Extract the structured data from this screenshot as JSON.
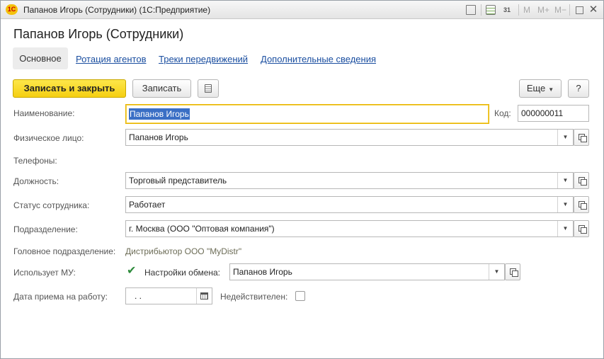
{
  "window": {
    "title": "Папанов Игорь (Сотрудники)  (1С:Предприятие)",
    "logo_text": "1С",
    "mem_buttons": [
      "M",
      "M+",
      "M−"
    ],
    "calendar_day": "31"
  },
  "header": {
    "title": "Папанов Игорь (Сотрудники)"
  },
  "tabs": [
    {
      "label": "Основное",
      "active": true
    },
    {
      "label": "Ротация агентов",
      "active": false
    },
    {
      "label": "Треки передвижений",
      "active": false
    },
    {
      "label": "Дополнительные сведения",
      "active": false
    }
  ],
  "toolbar": {
    "save_close_label": "Записать и закрыть",
    "save_label": "Записать",
    "more_label": "Еще",
    "help_label": "?"
  },
  "form": {
    "name_label": "Наименование:",
    "name_value": "Папанов Игорь",
    "code_label": "Код:",
    "code_value": "000000011",
    "person_label": "Физическое лицо:",
    "person_value": "Папанов Игорь",
    "phones_label": "Телефоны:",
    "position_label": "Должность:",
    "position_value": "Торговый представитель",
    "status_label": "Статус сотрудника:",
    "status_value": "Работает",
    "department_label": "Подразделение:",
    "department_value": "г. Москва  (ООО \"Оптовая компания\")",
    "head_department_label": "Головное подразделение:",
    "head_department_value": "Дистрибьютор ООО \"MyDistr\"",
    "uses_mu_label": "Использует МУ:",
    "uses_mu_checked": true,
    "exchange_settings_label": "Настройки обмена:",
    "exchange_settings_value": "Папанов Игорь",
    "hire_date_label": "Дата приема на работу:",
    "hire_date_value": " .  .",
    "invalid_label": "Недействителен:",
    "invalid_checked": false
  }
}
